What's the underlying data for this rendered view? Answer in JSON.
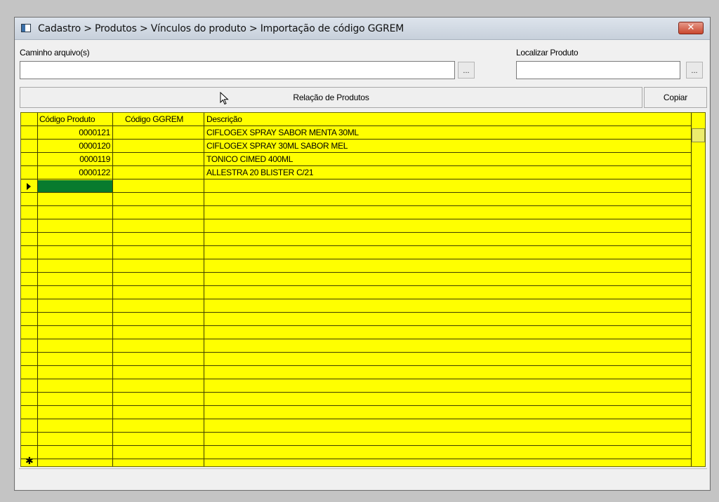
{
  "window": {
    "title": "Cadastro > Produtos > Vínculos do produto > Importação de código GGREM",
    "close_label": "✕"
  },
  "form": {
    "path_label": "Caminho arquivo(s)",
    "path_value": "",
    "path_browse": "...",
    "find_label": "Localizar Produto",
    "find_value": "",
    "find_browse": "..."
  },
  "actions": {
    "relacao_label": "Relação de Produtos",
    "copiar_label": "Copiar"
  },
  "grid": {
    "columns": [
      "Código Produto",
      "Código GGREM",
      "Descrição"
    ],
    "rows": [
      {
        "codigo": "0000121",
        "ggrem": "",
        "descricao": "CIFLOGEX SPRAY SABOR MENTA 30ML"
      },
      {
        "codigo": "0000120",
        "ggrem": "",
        "descricao": "CIFLOGEX SPRAY 30ML SABOR MEL"
      },
      {
        "codigo": "0000119",
        "ggrem": "",
        "descricao": "TONICO CIMED 400ML"
      },
      {
        "codigo": "0000122",
        "ggrem": "",
        "descricao": "ALLESTRA 20 BLISTER C/21"
      }
    ],
    "new_row_marker": "✱"
  },
  "colors": {
    "grid_background": "#ffff00",
    "current_cell": "#087b2e",
    "close_button": "#c9482f"
  }
}
